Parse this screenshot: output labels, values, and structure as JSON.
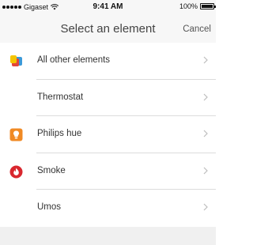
{
  "status_bar": {
    "carrier": "Gigaset",
    "time": "9:41 AM",
    "battery": "100%"
  },
  "header": {
    "title": "Select an element",
    "cancel_label": "Cancel"
  },
  "items": [
    {
      "label": "All other elements",
      "icon": "all-elements-icon"
    },
    {
      "label": "Thermostat",
      "icon": ""
    },
    {
      "label": "Philips hue",
      "icon": "philips-hue-icon"
    },
    {
      "label": "Smoke",
      "icon": "smoke-icon"
    },
    {
      "label": "Umos",
      "icon": ""
    }
  ],
  "colors": {
    "philips_hue": "#f08a24",
    "smoke": "#d9272e",
    "multi_yellow": "#f5c400",
    "multi_red": "#e2463a",
    "multi_blue": "#3b9ad9"
  }
}
